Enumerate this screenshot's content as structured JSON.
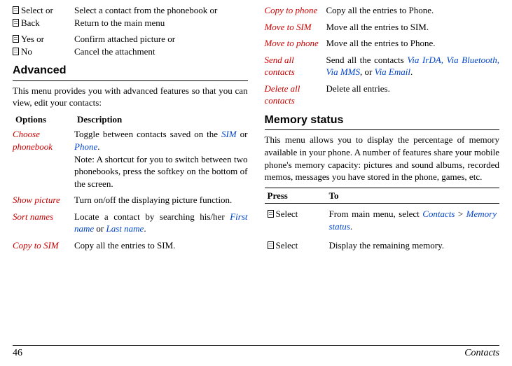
{
  "left": {
    "row1": {
      "opt1": "Select or",
      "opt2": "Back",
      "desc": "Select a contact from the phonebook or",
      "desc2": "Return to the main menu"
    },
    "row2": {
      "opt1": "Yes or",
      "opt2": "No",
      "desc": "Confirm attached picture or",
      "desc2": "Cancel the attachment"
    },
    "advanced_title": "Advanced",
    "advanced_intro": "This menu provides you with advanced features so that you can view, edit your contacts:",
    "th_options": "Options",
    "th_desc": "Description",
    "choose_phonebook": "Choose phonebook",
    "choose_desc1": "Toggle between contacts saved on the ",
    "sim": "SIM",
    "or_word": " or ",
    "phone": "Phone",
    "choose_desc2": "Note: A shortcut for you to switch between two phonebooks, press the softkey on the bottom of the screen.",
    "show_picture": "Show picture",
    "show_desc": "Turn on/off the displaying picture function.",
    "sort_names": "Sort names",
    "sort_desc1": "Locate a contact by searching his/her ",
    "first_name": "First name",
    "last_name": "Last name",
    "copy_sim": "Copy to SIM",
    "copy_sim_desc": "Copy all the entries to SIM."
  },
  "right": {
    "copy_phone": "Copy to phone",
    "copy_phone_desc": "Copy all the entries to Phone.",
    "move_sim": "Move to SIM",
    "move_sim_desc": "Move all the entries to SIM.",
    "move_phone": "Move to phone",
    "move_phone_desc": "Move all the entries to Phone.",
    "send_all": "Send all contacts",
    "send_desc1": "Send all the contacts ",
    "via_irda": "Via IrDA,",
    "via_bt": "Via Bluetooth,",
    "via_mms": "Via MMS",
    "comma_or": ", or ",
    "via_email": "Via Email",
    "delete_all": "Delete all contacts",
    "delete_desc": "Delete all entries.",
    "memory_title": "Memory status",
    "memory_intro": "This menu allows you to display the percentage of memory available in your phone. A number of features share your mobile phone's memory capacity: pictures and sound albums, recorded memos, messages you have stored in the phone, games, etc.",
    "th_press": "Press",
    "th_to": "To",
    "select1": "Select",
    "select1_desc1": "From main menu, select ",
    "contacts_link": "Contacts",
    "gt": " > ",
    "memstatus_link": "Memory status",
    "select2": "Select",
    "select2_desc": "Display the remaining memory."
  },
  "footer": {
    "page": "46",
    "section": "Contacts"
  }
}
